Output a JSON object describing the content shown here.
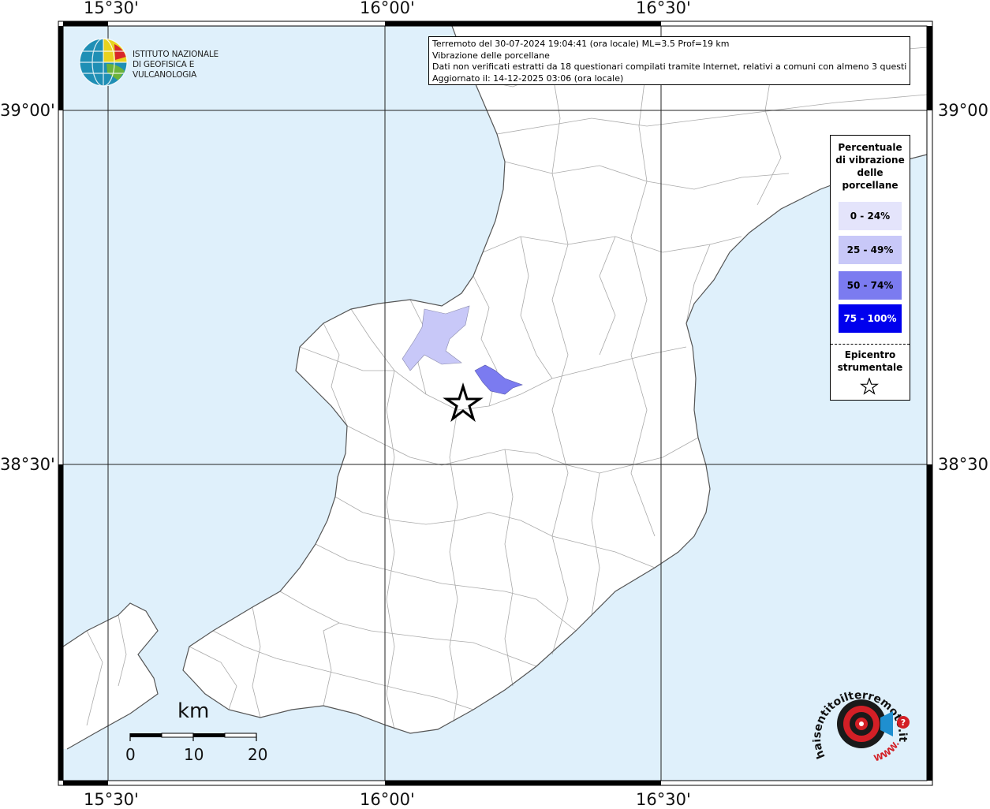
{
  "map": {
    "lon_labels": [
      "15°30'",
      "16°00'",
      "16°30'"
    ],
    "lat_labels": [
      "39°00'",
      "38°30'"
    ],
    "colors": {
      "sea": "#dff0fb",
      "land": "#ffffff",
      "boundary": "#aaaaaa",
      "coast": "#555555",
      "grid": "#222222",
      "class_25_49": "#c8c8f8",
      "class_50_74": "#7b7bf0"
    }
  },
  "info": {
    "line1": "Terremoto del 30-07-2024 19:04:41 (ora locale) ML=3.5 Prof=19 km",
    "line2": "Vibrazione delle porcellane",
    "line3": "Dati non verificati estratti da 18 questionari compilati tramite Internet, relativi a comuni con almeno 3 questionari.",
    "line4": "Aggiornato il: 14-12-2025 03:06 (ora locale)"
  },
  "legend": {
    "title": "Percentuale di vibrazione delle porcellane",
    "classes": [
      {
        "label": "0 - 24%",
        "color": "#e4e4fb",
        "text_color": "#000000"
      },
      {
        "label": "25 - 49%",
        "color": "#c8c8f8",
        "text_color": "#000000"
      },
      {
        "label": "50 - 74%",
        "color": "#7b7bf0",
        "text_color": "#000000"
      },
      {
        "label": "75 - 100%",
        "color": "#0000ee",
        "text_color": "#ffffff"
      }
    ],
    "epicenter_label": "Epicentro strumentale",
    "epicenter_icon": "star-outline-icon"
  },
  "logos": {
    "ingv_line1": "ISTITUTO NAZIONALE",
    "ingv_line2": "DI GEOFISICA E VULCANOLOGIA",
    "hst_text": "haisentitoilterremoto.it",
    "hst_www": "WWW."
  },
  "scale": {
    "unit": "km",
    "labels": [
      "0",
      "10",
      "20"
    ]
  }
}
